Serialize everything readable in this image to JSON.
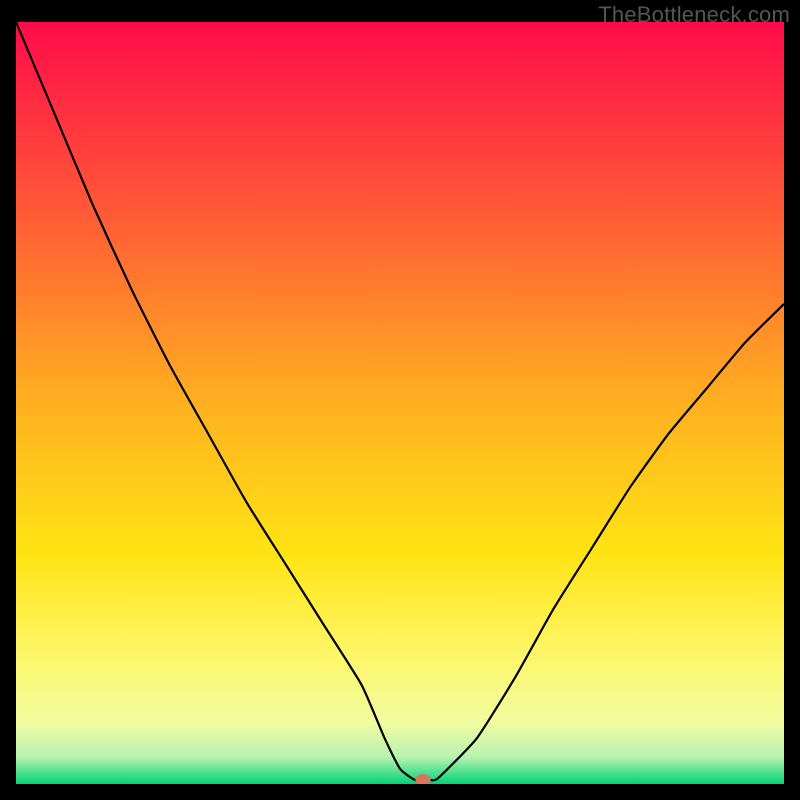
{
  "watermark": "TheBottleneck.com",
  "chart_data": {
    "type": "line",
    "title": "",
    "xlabel": "",
    "ylabel": "",
    "xlim": [
      0,
      100
    ],
    "ylim": [
      0,
      100
    ],
    "background": {
      "type": "vertical-gradient",
      "stops": [
        {
          "pos": 0.0,
          "color": "#ff0b4a"
        },
        {
          "pos": 0.25,
          "color": "#ff5a36"
        },
        {
          "pos": 0.5,
          "color": "#ffb020"
        },
        {
          "pos": 0.7,
          "color": "#ffe414"
        },
        {
          "pos": 0.84,
          "color": "#fdf76e"
        },
        {
          "pos": 0.92,
          "color": "#f0fca0"
        },
        {
          "pos": 0.965,
          "color": "#b6f2b0"
        },
        {
          "pos": 0.985,
          "color": "#4de08e"
        },
        {
          "pos": 1.0,
          "color": "#00d475"
        }
      ]
    },
    "series": [
      {
        "name": "bottleneck-curve",
        "color": "#000000",
        "x": [
          0,
          5,
          10,
          15,
          20,
          25,
          30,
          35,
          40,
          45,
          48,
          50,
          52,
          54,
          55,
          60,
          65,
          70,
          75,
          80,
          85,
          90,
          95,
          100
        ],
        "y": [
          100,
          88,
          76,
          65,
          55,
          46,
          37,
          29,
          21,
          13,
          6,
          2,
          0.5,
          0.5,
          0.8,
          6,
          14,
          23,
          31,
          39,
          46,
          52,
          58,
          63
        ]
      }
    ],
    "marker": {
      "name": "current-point",
      "x": 53,
      "y": 0.5,
      "color": "#d9745f",
      "shape": "rounded-rect"
    }
  }
}
